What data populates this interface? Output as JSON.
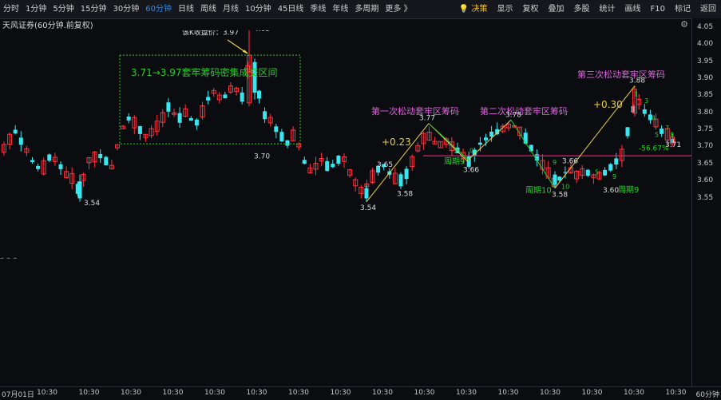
{
  "toolbar": {
    "left_items": [
      "分时",
      "1分钟",
      "5分钟",
      "15分钟",
      "30分钟",
      "60分钟",
      "日线",
      "周线",
      "月线",
      "10分钟",
      "45日线",
      "季线",
      "年线",
      "多周期",
      "更多 》"
    ],
    "active_index": 5,
    "right_items": [
      "决策",
      "显示",
      "复权",
      "叠加",
      "多股",
      "统计",
      "画线",
      "F10",
      "标记",
      "返回"
    ],
    "highlight_index": 0
  },
  "title": "天风证券(60分钟.前复权)",
  "gear_icon": "⚙",
  "dash_marker": "– – –",
  "axis": {
    "y_ticks": [
      "4.05",
      "4.00",
      "3.95",
      "3.90",
      "3.85",
      "3.80",
      "3.75",
      "3.70",
      "3.65",
      "3.60",
      "3.55"
    ],
    "x_start": "07月01日",
    "x_labels": [
      "10:30",
      "10:30",
      "10:30",
      "10:30",
      "10:30",
      "10:30",
      "10:30",
      "10:30",
      "10:30",
      "10:30",
      "10:30",
      "10:30",
      "10:30",
      "10:30",
      "10:30",
      "10:30"
    ],
    "x_right": "60分钟"
  },
  "annotations": {
    "close_note": "该K收盘价：3.97",
    "high_label": "4.05",
    "box_text": "3.71→3.97套牢筹码密集成交区间",
    "low1": "3.54",
    "p370": "3.70",
    "first_title": "第一次松动套牢区筹码",
    "second_title": "第二次松动套牢区筹码",
    "third_title": "第三次松动套牢区筹码",
    "gain1": "+0.23",
    "gain3": "+0.30",
    "p377": "3.77",
    "p378": "3.78",
    "p388": "3.88",
    "p365": "3.65",
    "p358a": "3.58",
    "p354": "3.54",
    "p366a": "3.66",
    "p366b": "3.66",
    "p358b": "3.58",
    "p360": "3.60",
    "p371": "3.71",
    "cycle9a": "周期9",
    "cycle10": "周期10",
    "cycle9b": "周期9",
    "pct": "-56.67%",
    "n5": "5",
    "n9a": "9",
    "n9b": "9",
    "n10": "10",
    "n5b": "5",
    "n9c": "9",
    "n1": "1",
    "n3": "3",
    "n4": "4",
    "n5c": "5",
    "n7": "7",
    "n8": "8"
  },
  "colors": {
    "up": "#ff3340",
    "down": "#39e6f0",
    "green": "#22d022",
    "gold": "#e8d040",
    "magenta": "#e060e0",
    "hline": "#e0206a"
  }
}
